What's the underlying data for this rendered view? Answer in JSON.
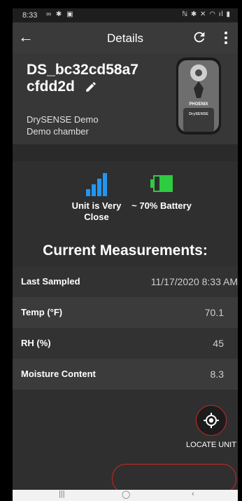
{
  "status_bar": {
    "time": "8:33",
    "left_icons": "∞ ✱ ▣",
    "right_icons": "ℕ ✱ ✕ ◠ ıl ▮"
  },
  "app_bar": {
    "title": "Details"
  },
  "device": {
    "name": "DS_bc32cd58a7 cfdd2d",
    "org": "DrySENSE Demo",
    "chamber": "Demo chamber",
    "brand_label": "PHOENIX",
    "product_label": "DrySENSE"
  },
  "signal": {
    "label": "Unit is Very Close",
    "bars": 4
  },
  "battery": {
    "label": "~ 70% Battery",
    "level": 0.7
  },
  "measurements": {
    "heading": "Current Measurements:",
    "rows": [
      {
        "label": "Last Sampled",
        "value": "11/17/2020 8:33 AM"
      },
      {
        "label": "Temp (°F)",
        "value": "70.1"
      },
      {
        "label": "RH (%)",
        "value": "45"
      },
      {
        "label": "Moisture Content",
        "value": "8.3"
      }
    ]
  },
  "locate": {
    "label": "LOCATE UNIT"
  },
  "colors": {
    "accent_blue": "#2196f3",
    "battery_green": "#2ecc40",
    "locate_ring": "#c62828"
  }
}
